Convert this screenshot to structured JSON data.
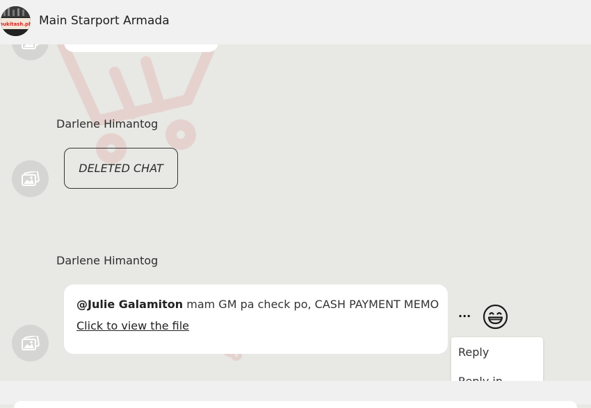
{
  "header": {
    "title": "Main Starport Armada",
    "avatar_text": "bukitash.ph"
  },
  "messages": [
    {
      "sender": "Darlene Himantog",
      "text": "DELETED CHAT"
    },
    {
      "sender": "Darlene Himantog",
      "mention": "@Julie Galamiton",
      "text": " mam GM pa check po, CASH PAYMENT MEMO",
      "file_link": "Click to view the file"
    }
  ],
  "actions": {
    "more_label": "...",
    "emoji_icon": "grinning-face-icon"
  },
  "context_menu": {
    "items": [
      "Reply",
      "Reply in"
    ]
  },
  "colors": {
    "chat_background": "#e8e8e4",
    "header_background": "#f1f1f1",
    "bubble": "#ffffff",
    "watermark": "#d9534f"
  }
}
